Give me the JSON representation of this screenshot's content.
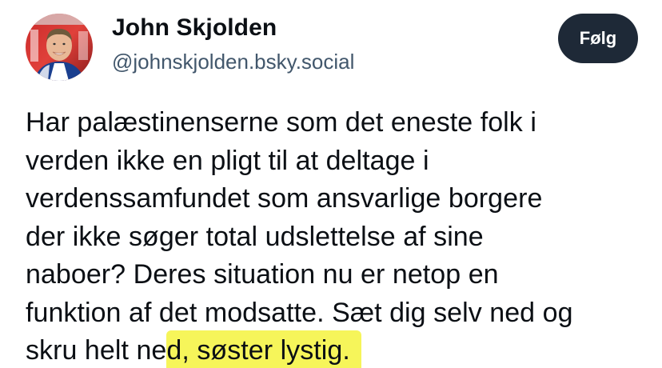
{
  "author": {
    "display_name": "John Skjolden",
    "handle": "@johnskjolden.bsky.social"
  },
  "actions": {
    "follow_label": "Følg"
  },
  "post": {
    "lines": [
      "Har palæstinenserne som det eneste folk i",
      "verden ikke en pligt til at deltage i",
      "verdenssamfundet som ansvarlige borgere",
      "der ikke søger total udslettelse af sine",
      "naboer? Deres situation nu er netop en",
      "funktion af det modsatte. Sæt dig selv ned og"
    ],
    "last_line_plain": "skru helt ne",
    "last_line_highlighted": "d, søster lystig."
  },
  "colors": {
    "follow_button_bg": "#1e2937",
    "highlight": "#f6f55a",
    "handle_text": "#42576c"
  }
}
